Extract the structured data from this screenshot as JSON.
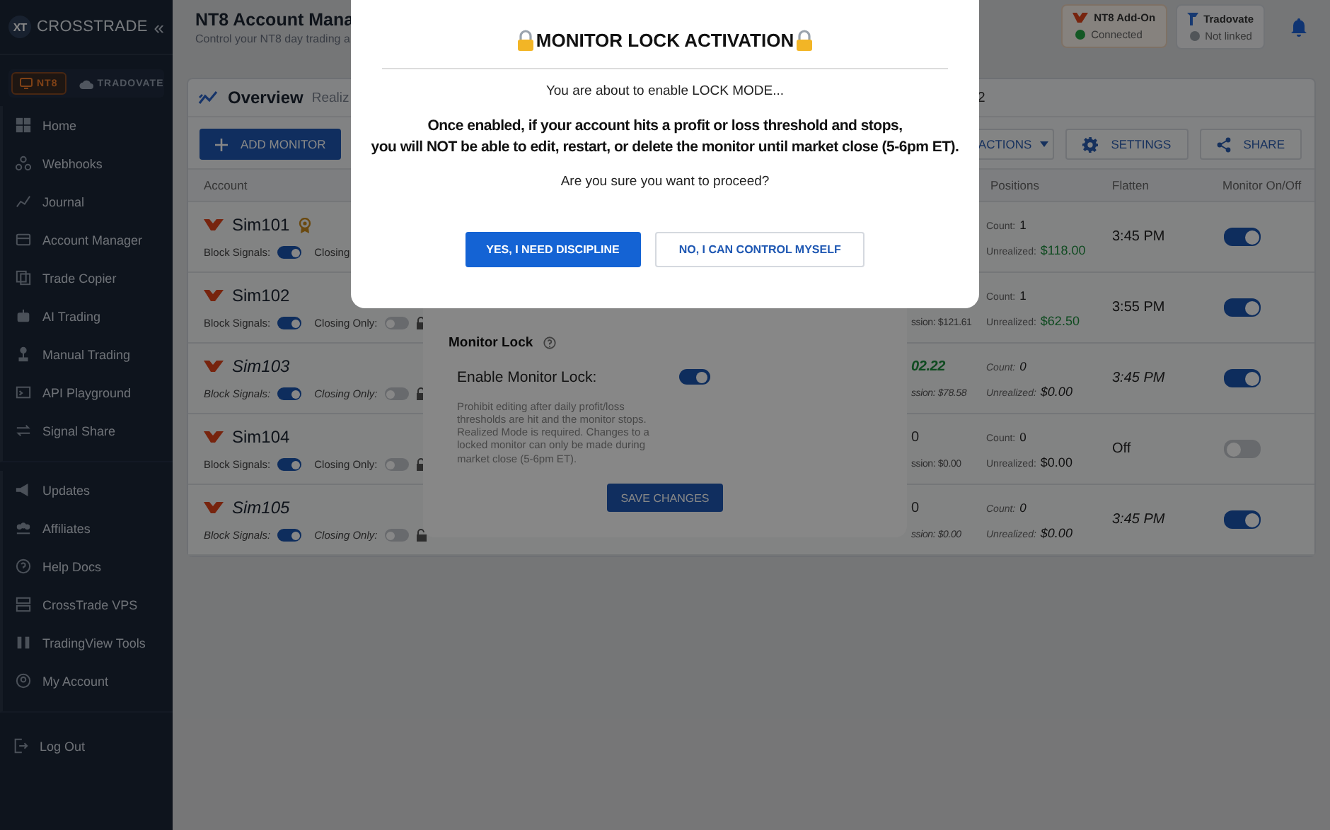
{
  "sidebar": {
    "logo": "XT",
    "brand": "CROSSTRADE",
    "collapse": "«",
    "platform_tabs": [
      {
        "label": "NT8",
        "selected": true
      },
      {
        "label": "TRADOVATE",
        "selected": false
      }
    ],
    "nav_groups": [
      [
        {
          "label": "Home"
        },
        {
          "label": "Webhooks"
        },
        {
          "label": "Journal"
        },
        {
          "label": "Account Manager"
        },
        {
          "label": "Trade Copier"
        },
        {
          "label": "AI Trading"
        },
        {
          "label": "Manual Trading"
        },
        {
          "label": "API Playground"
        },
        {
          "label": "Signal Share"
        }
      ],
      [
        {
          "label": "Updates"
        },
        {
          "label": "Affiliates"
        },
        {
          "label": "Help Docs"
        },
        {
          "label": "CrossTrade VPS"
        },
        {
          "label": "TradingView Tools"
        },
        {
          "label": "My Account"
        }
      ],
      [
        {
          "label": "Log Out"
        }
      ]
    ]
  },
  "header": {
    "title": "NT8 Account Mana",
    "subtitle": "Control your NT8 day trading a",
    "connections": [
      {
        "name": "NT8 Add-On",
        "status": "Connected",
        "connected": true
      },
      {
        "name": "Tradovate",
        "status": "Not linked",
        "connected": false
      }
    ]
  },
  "overview": {
    "title": "Overview",
    "tab_fragment": "Realiz",
    "count_fragment": "2"
  },
  "toolbar": {
    "add": "ADD MONITOR",
    "actions": "ACTIONS",
    "settings": "SETTINGS",
    "share": "SHARE"
  },
  "table": {
    "columns": [
      "Account",
      "Positions",
      "Flatten",
      "Monitor On/Off"
    ],
    "rows": [
      {
        "account": "Sim101",
        "badge": true,
        "inactive": false,
        "block_label": "Block Signals:",
        "block_signals": true,
        "closing_label": "Closing",
        "count_label": "Count:",
        "count": "1",
        "unrealized_label": "Unrealized:",
        "unrealized": "$118.00",
        "positive": true,
        "flatten": "3:45 PM",
        "monitor_on": true
      },
      {
        "account": "Sim102",
        "badge": false,
        "inactive": false,
        "block_label": "Block Signals:",
        "block_signals": true,
        "closing_label": "Closing Only:",
        "closing_only": false,
        "column_3": {
          "line_2": "ssion: $121.61"
        },
        "count_label": "Count:",
        "count": "1",
        "unrealized_label": "Unrealized:",
        "unrealized": "$62.50",
        "positive": true,
        "flatten": "3:55 PM",
        "monitor_on": true
      },
      {
        "account": "Sim103",
        "badge": false,
        "inactive": true,
        "block_label": "Block Signals:",
        "block_signals": true,
        "closing_label": "Closing Only:",
        "closing_only": false,
        "column_3": {
          "line_1": "02.22",
          "line_2": "ssion: $78.58",
          "positive": true
        },
        "count_label": "Count:",
        "count": "0",
        "unrealized_label": "Unrealized:",
        "unrealized": "$0.00",
        "positive": false,
        "flatten": "3:45 PM",
        "monitor_on": true
      },
      {
        "account": "Sim104",
        "badge": false,
        "inactive": false,
        "block_label": "Block Signals:",
        "block_signals": true,
        "closing_label": "Closing Only:",
        "closing_only": false,
        "column_3": {
          "line_1": "0",
          "line_2": "ssion: $0.00",
          "positive": false
        },
        "count_label": "Count:",
        "count": "0",
        "unrealized_label": "Unrealized:",
        "unrealized": "$0.00",
        "positive": false,
        "flatten": "Off",
        "monitor_on": false
      },
      {
        "account": "Sim105",
        "badge": false,
        "inactive": true,
        "block_label": "Block Signals:",
        "block_signals": true,
        "closing_label": "Closing Only:",
        "closing_only": false,
        "column_3": {
          "line_1": "0",
          "line_2": "ssion: $0.00",
          "positive": false
        },
        "count_label": "Count:",
        "count": "0",
        "unrealized_label": "Unrealized:",
        "unrealized": "$0.00",
        "positive": false,
        "flatten": "3:45 PM",
        "monitor_on": true
      }
    ]
  },
  "settings_modal": {
    "section": "Monitor Lock",
    "toggle_label": "Enable Monitor Lock:",
    "enabled": true,
    "description": "Prohibit editing after daily profit/loss thresholds are hit and the monitor stops. Realized Mode is required. Changes to a locked monitor can only be made during market close (5-6pm ET).",
    "save": "SAVE CHANGES"
  },
  "confirm_dialog": {
    "title": "MONITOR LOCK ACTIVATION",
    "intro": "You are about to enable LOCK MODE...",
    "warning_lines": [
      "Once enabled, if your account hits a profit or loss threshold and stops,",
      "you will NOT be able to edit, restart, or delete the monitor until market close (5-6pm ET)."
    ],
    "question": "Are you sure you want to proceed?",
    "confirm": "YES, I NEED DISCIPLINE",
    "cancel": "NO, I CAN CONTROL MYSELF"
  }
}
